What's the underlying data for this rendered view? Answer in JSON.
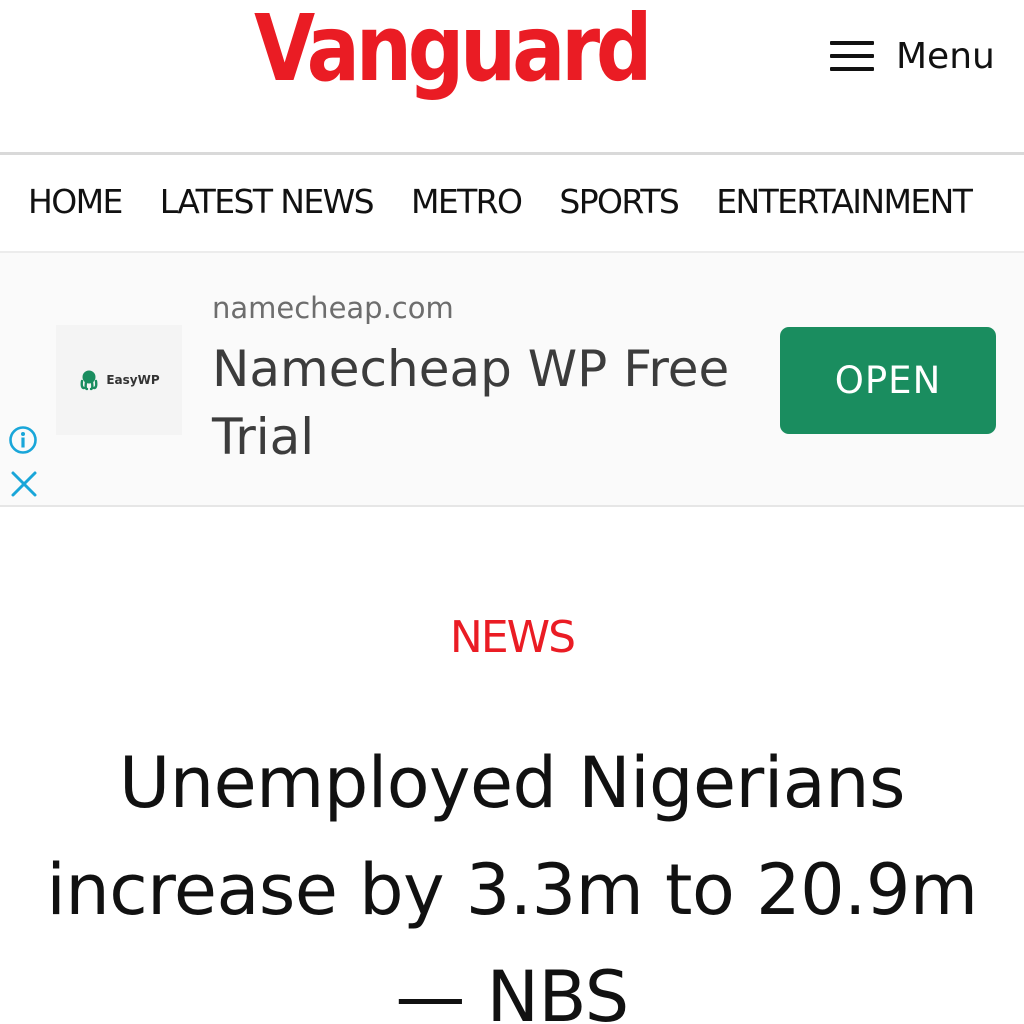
{
  "header": {
    "logo_text": "Vanguard",
    "menu_label": "Menu",
    "brand_color": "#ea1c24"
  },
  "nav": {
    "items": [
      {
        "label": "HOME"
      },
      {
        "label": "LATEST NEWS"
      },
      {
        "label": "METRO"
      },
      {
        "label": "SPORTS"
      },
      {
        "label": "ENTERTAINMENT"
      }
    ]
  },
  "ad": {
    "logo_text": "EasyWP",
    "domain": "namecheap.com",
    "headline": "Namecheap WP Free Trial",
    "cta_label": "OPEN",
    "cta_color": "#1a8d5f",
    "icons": [
      "info-icon",
      "close-icon",
      "octopus-icon"
    ]
  },
  "article": {
    "category": "NEWS",
    "title": "Unemployed Nigerians increase by 3.3m to 20.9m — NBS"
  }
}
